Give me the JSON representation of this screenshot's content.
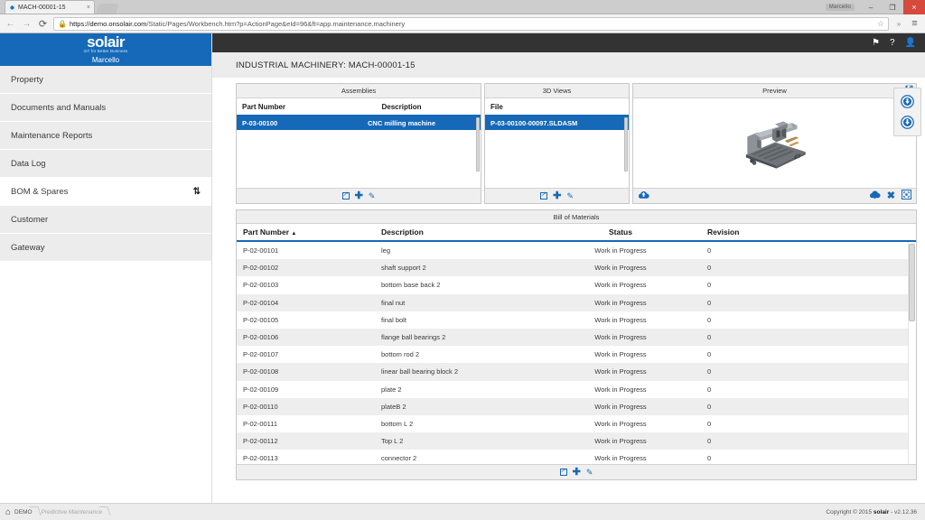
{
  "browser": {
    "tab_title": "MACH-00001-15",
    "tab_close": "×",
    "back_icon": "←",
    "forward_icon": "→",
    "reload_icon": "⟳",
    "lock_icon": "🔒",
    "url_host": "https://demo.onsolair.com",
    "url_path": "/Static/Pages/Workbench.htm?p=ActionPage&eId=96&ft=app.maintenance.machinery",
    "star_icon": "☆",
    "extension_icon": "»",
    "menu_icon": "≡",
    "window_user": "Marcello",
    "minimize": "–",
    "maximize": "❐",
    "close": "×"
  },
  "sidebar": {
    "logo": "solair",
    "tagline": "IoT for Better Business",
    "user": "Marcello",
    "items": [
      {
        "label": "Property",
        "active": false
      },
      {
        "label": "Documents and Manuals",
        "active": false
      },
      {
        "label": "Maintenance Reports",
        "active": false
      },
      {
        "label": "Data Log",
        "active": false
      },
      {
        "label": "BOM & Spares",
        "active": true,
        "sort_icon": "⇅"
      },
      {
        "label": "Customer",
        "active": false
      },
      {
        "label": "Gateway",
        "active": false
      }
    ]
  },
  "topbar": {
    "flag_icon": "⚑",
    "help_icon": "?",
    "user_icon": "👤"
  },
  "page_title": "INDUSTRIAL MACHINERY: MACH-00001-15",
  "assemblies": {
    "title": "Assemblies",
    "columns": {
      "part_number": "Part Number",
      "description": "Description"
    },
    "rows": [
      {
        "part_number": "P-03-00100",
        "description": "CNC milling machine",
        "selected": true
      }
    ],
    "footer_icons": [
      "export-icon",
      "add-icon",
      "edit-icon"
    ]
  },
  "views_3d": {
    "title": "3D Views",
    "columns": {
      "file": "File"
    },
    "rows": [
      {
        "file": "P-03-00100-00097.SLDASM",
        "selected": true
      }
    ],
    "footer_icons": [
      "export-icon",
      "add-icon",
      "edit-icon"
    ]
  },
  "preview": {
    "title": "Preview",
    "save_icon": "💾",
    "upload_icon": "cloud-upload-icon",
    "download_icon": "cloud-download-icon",
    "delete_icon": "✖",
    "fullscreen_icon": "fullscreen-icon"
  },
  "bom": {
    "title": "Bill of Materials",
    "columns": {
      "part_number": "Part Number",
      "sort_indicator": "▲",
      "description": "Description",
      "status": "Status",
      "revision": "Revision"
    },
    "rows": [
      {
        "part_number": "P-02-00101",
        "description": "leg",
        "status": "Work in Progress",
        "revision": "0"
      },
      {
        "part_number": "P-02-00102",
        "description": "shaft support 2",
        "status": "Work in Progress",
        "revision": "0"
      },
      {
        "part_number": "P-02-00103",
        "description": "bottom base back 2",
        "status": "Work in Progress",
        "revision": "0"
      },
      {
        "part_number": "P-02-00104",
        "description": "final nut",
        "status": "Work in Progress",
        "revision": "0"
      },
      {
        "part_number": "P-02-00105",
        "description": "final bolt",
        "status": "Work in Progress",
        "revision": "0"
      },
      {
        "part_number": "P-02-00106",
        "description": "flange ball bearings 2",
        "status": "Work in Progress",
        "revision": "0"
      },
      {
        "part_number": "P-02-00107",
        "description": "bottom rod 2",
        "status": "Work in Progress",
        "revision": "0"
      },
      {
        "part_number": "P-02-00108",
        "description": "linear ball bearing block 2",
        "status": "Work in Progress",
        "revision": "0"
      },
      {
        "part_number": "P-02-00109",
        "description": "plate 2",
        "status": "Work in Progress",
        "revision": "0"
      },
      {
        "part_number": "P-02-00110",
        "description": "plateB 2",
        "status": "Work in Progress",
        "revision": "0"
      },
      {
        "part_number": "P-02-00111",
        "description": "bottom L 2",
        "status": "Work in Progress",
        "revision": "0"
      },
      {
        "part_number": "P-02-00112",
        "description": "Top L 2",
        "status": "Work in Progress",
        "revision": "0"
      },
      {
        "part_number": "P-02-00113",
        "description": "connector 2",
        "status": "Work in Progress",
        "revision": "0"
      }
    ],
    "footer_icons": [
      "export-icon",
      "add-icon",
      "edit-icon"
    ]
  },
  "dock": {
    "buttons": [
      "download-circle-icon",
      "download-circle-icon"
    ]
  },
  "footer": {
    "home_icon": "⌂",
    "breadcrumb_root": "DEMO",
    "breadcrumb_current": "Predictive Maintenance",
    "copyright_prefix": "Copyright © 2015",
    "copyright_brand": "solair",
    "copyright_version": "- v2.12.36"
  },
  "colors": {
    "brand_blue": "#1669b8",
    "dark_bar": "#333333",
    "panel_grey": "#efefef",
    "row_alt": "#eeeeee"
  }
}
